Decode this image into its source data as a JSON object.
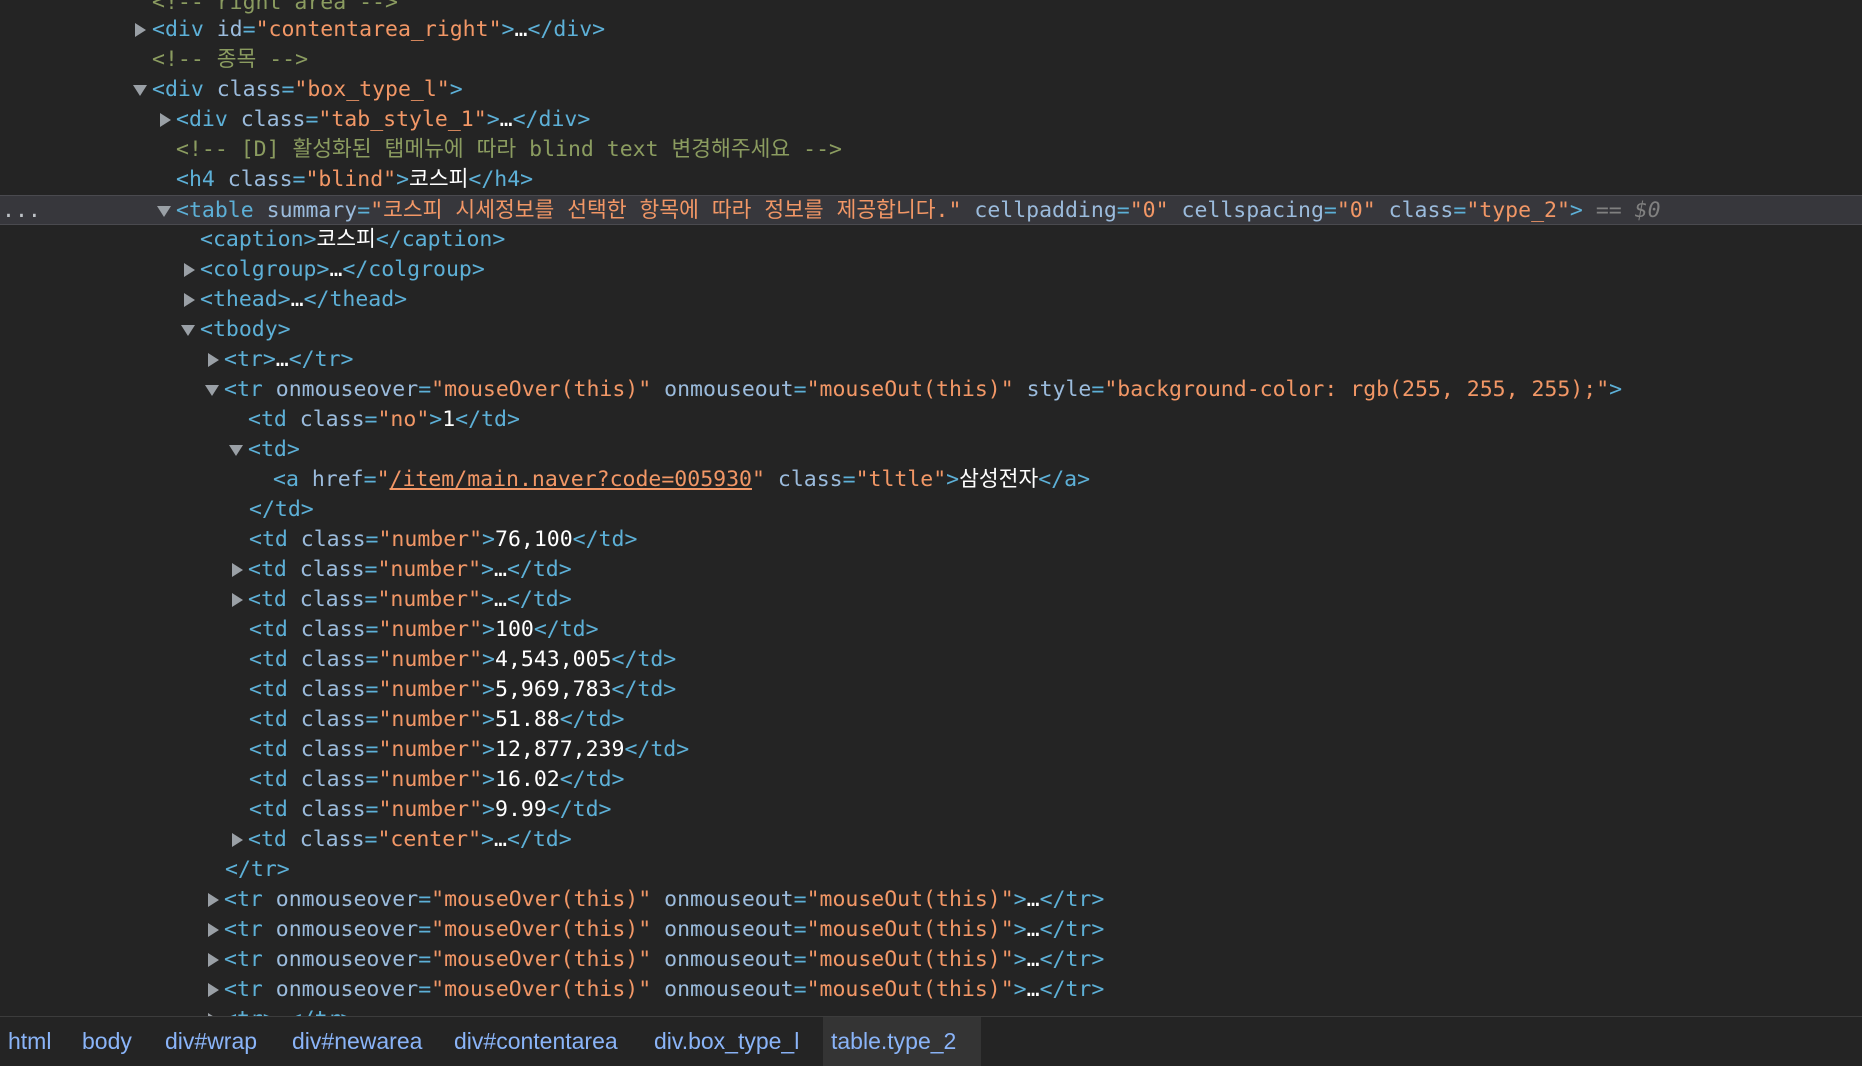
{
  "tree": {
    "row_label_ellipsis": "...",
    "l00": {
      "comment": "<!-- right area -->"
    },
    "l01": {
      "tag_open": "<div",
      "attr1": "id",
      "val1": "\"contentarea_right\"",
      "close": ">",
      "ellipsis": "…",
      "end_tag": "</div>"
    },
    "l02": {
      "comment": "<!-- 종목 -->"
    },
    "l03": {
      "tag_open": "<div",
      "attr1": "class",
      "val1": "\"box_type_l\"",
      "close": ">"
    },
    "l04": {
      "tag_open": "<div",
      "attr1": "class",
      "val1": "\"tab_style_1\"",
      "close": ">",
      "ellipsis": "…",
      "end_tag": "</div>"
    },
    "l05": {
      "comment": "<!-- [D] 활성화된 탭메뉴에 따라 blind text 변경해주세요 -->"
    },
    "l06": {
      "tag_open": "<h4",
      "attr1": "class",
      "val1": "\"blind\"",
      "close": ">",
      "text": "코스피",
      "end_tag": "</h4>"
    },
    "l07": {
      "tag_open": "<table",
      "attr1": "summary",
      "val1": "\"코스피 시세정보를 선택한 항목에 따라 정보를 제공합니다.\"",
      "attr2": "cellpadding",
      "val2": "\"0\"",
      "attr3": "cellspacing",
      "val3": "\"0\"",
      "attr4": "class",
      "val4": "\"type_2\"",
      "close": ">",
      "marker": "==",
      "dollar": "$0"
    },
    "l08": {
      "tag_open": "<caption>",
      "text": "코스피",
      "end_tag": "</caption>"
    },
    "l09": {
      "tag_open": "<colgroup>",
      "ellipsis": "…",
      "end_tag": "</colgroup>"
    },
    "l10": {
      "tag_open": "<thead>",
      "ellipsis": "…",
      "end_tag": "</thead>"
    },
    "l11": {
      "tag_open": "<tbody>"
    },
    "l12": {
      "tag_open": "<tr>",
      "ellipsis": "…",
      "end_tag": "</tr>"
    },
    "l13": {
      "tag_open": "<tr",
      "attr1": "onmouseover",
      "val1": "\"mouseOver(this)\"",
      "attr2": "onmouseout",
      "val2": "\"mouseOut(this)\"",
      "attr3": "style",
      "val3": "\"background-color: rgb(255, 255, 255);\"",
      "close": ">"
    },
    "l14": {
      "tag_open": "<td",
      "attr1": "class",
      "val1": "\"no\"",
      "close": ">",
      "text": "1",
      "end_tag": "</td>"
    },
    "l15": {
      "tag_open": "<td>"
    },
    "l16": {
      "tag_open": "<a",
      "attr1": "href",
      "q1": "\"",
      "href": "/item/main.naver?code=005930",
      "q2": "\"",
      "attr2": "class",
      "val2": "\"tltle\"",
      "close": ">",
      "text": "삼성전자",
      "end_tag": "</a>"
    },
    "l17": {
      "end_tag": "</td>"
    },
    "l18": {
      "tag_open": "<td",
      "attr1": "class",
      "val1": "\"number\"",
      "close": ">",
      "text": "76,100",
      "end_tag": "</td>"
    },
    "l19": {
      "tag_open": "<td",
      "attr1": "class",
      "val1": "\"number\"",
      "close": ">",
      "ellipsis": "…",
      "end_tag": "</td>"
    },
    "l20": {
      "tag_open": "<td",
      "attr1": "class",
      "val1": "\"number\"",
      "close": ">",
      "ellipsis": "…",
      "end_tag": "</td>"
    },
    "l21": {
      "tag_open": "<td",
      "attr1": "class",
      "val1": "\"number\"",
      "close": ">",
      "text": "100",
      "end_tag": "</td>"
    },
    "l22": {
      "tag_open": "<td",
      "attr1": "class",
      "val1": "\"number\"",
      "close": ">",
      "text": "4,543,005",
      "end_tag": "</td>"
    },
    "l23": {
      "tag_open": "<td",
      "attr1": "class",
      "val1": "\"number\"",
      "close": ">",
      "text": "5,969,783",
      "end_tag": "</td>"
    },
    "l24": {
      "tag_open": "<td",
      "attr1": "class",
      "val1": "\"number\"",
      "close": ">",
      "text": "51.88",
      "end_tag": "</td>"
    },
    "l25": {
      "tag_open": "<td",
      "attr1": "class",
      "val1": "\"number\"",
      "close": ">",
      "text": "12,877,239",
      "end_tag": "</td>"
    },
    "l26": {
      "tag_open": "<td",
      "attr1": "class",
      "val1": "\"number\"",
      "close": ">",
      "text": "16.02",
      "end_tag": "</td>"
    },
    "l27": {
      "tag_open": "<td",
      "attr1": "class",
      "val1": "\"number\"",
      "close": ">",
      "text": "9.99",
      "end_tag": "</td>"
    },
    "l28": {
      "tag_open": "<td",
      "attr1": "class",
      "val1": "\"center\"",
      "close": ">",
      "ellipsis": "…",
      "end_tag": "</td>"
    },
    "l29": {
      "end_tag": "</tr>"
    },
    "l30": {
      "tag_open": "<tr",
      "attr1": "onmouseover",
      "val1": "\"mouseOver(this)\"",
      "attr2": "onmouseout",
      "val2": "\"mouseOut(this)\"",
      "close": ">",
      "ellipsis": "…",
      "end_tag": "</tr>"
    },
    "l31": {
      "tag_open": "<tr",
      "attr1": "onmouseover",
      "val1": "\"mouseOver(this)\"",
      "attr2": "onmouseout",
      "val2": "\"mouseOut(this)\"",
      "close": ">",
      "ellipsis": "…",
      "end_tag": "</tr>"
    },
    "l32": {
      "tag_open": "<tr",
      "attr1": "onmouseover",
      "val1": "\"mouseOver(this)\"",
      "attr2": "onmouseout",
      "val2": "\"mouseOut(this)\"",
      "close": ">",
      "ellipsis": "…",
      "end_tag": "</tr>"
    },
    "l33": {
      "tag_open": "<tr",
      "attr1": "onmouseover",
      "val1": "\"mouseOver(this)\"",
      "attr2": "onmouseout",
      "val2": "\"mouseOut(this)\"",
      "close": ">",
      "ellipsis": "…",
      "end_tag": "</tr>"
    },
    "l34": {
      "tag_open": "<tr>",
      "ellipsis": "…",
      "end_tag": "</tr>"
    }
  },
  "breadcrumbs": [
    "html",
    "body",
    "div#wrap",
    "div#newarea",
    "div#contentarea",
    "div.box_type_l",
    "table.type_2"
  ],
  "colors": {
    "background": "#242424",
    "tag": "#5db0d7",
    "attr_name": "#9bbbdc",
    "attr_value": "#f29766",
    "comment": "#8b9c60",
    "breadcrumb": "#8ab4f8"
  }
}
